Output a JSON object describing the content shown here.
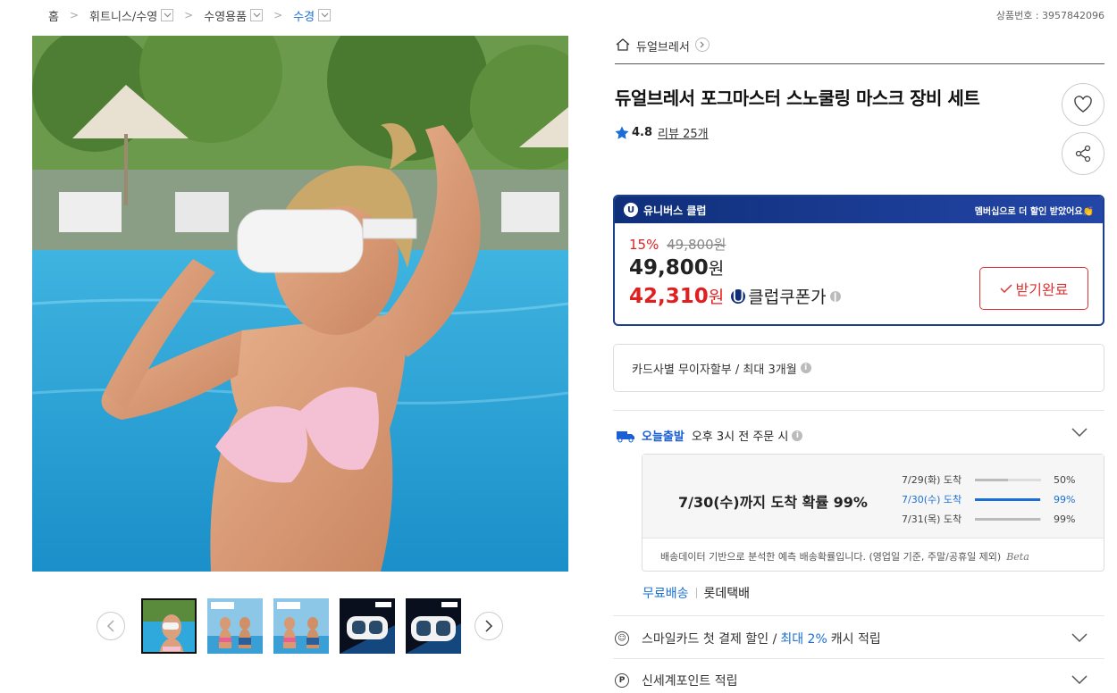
{
  "breadcrumb": {
    "items": [
      "홈",
      "휘트니스/수영",
      "수영용품",
      "수경"
    ],
    "current_index": 3
  },
  "product_number": "상품번호 : 3957842096",
  "brand": {
    "name": "듀얼브레서"
  },
  "product": {
    "title": "듀얼브레서 포그마스터 스노쿨링 마스크 장비 세트",
    "rating": "4.8",
    "review_text": "리뷰 25개"
  },
  "club": {
    "name": "유니버스 클럽",
    "promo": "멤버십으로 더 할인 받았어요👏",
    "discount_pct": "15%",
    "original_price": "49,800원",
    "price_num": "49,800",
    "price_unit": "원",
    "club_price_num": "42,310",
    "club_price_unit": "원",
    "coupon_label": "클럽쿠폰가",
    "receive_button": "받기완료"
  },
  "card": {
    "text": "카드사별 무이자할부 / 최대 3개월"
  },
  "delivery": {
    "badge": "오늘출발",
    "text": "오후 3시 전 주문 시",
    "headline": "7/30(수)까지 도착 확률 99%",
    "rows": [
      {
        "label": "7/29(화) 도착",
        "percent": "50%",
        "value": 0.5,
        "active": false
      },
      {
        "label": "7/30(수) 도착",
        "percent": "99%",
        "value": 0.99,
        "active": true
      },
      {
        "label": "7/31(목) 도착",
        "percent": "99%",
        "value": 0.99,
        "active": false
      }
    ],
    "note": "배송데이터 기반으로 분석한 예측 배송확률입니다. (영업일 기준, 주말/공휴일 제외)",
    "beta": "Beta"
  },
  "shipping": {
    "free": "무료배송",
    "carrier": "롯데택배"
  },
  "benefits": [
    {
      "pre": "스마일카드 첫 결제 할인 /",
      "highlight": "최대 2%",
      "post": "캐시 적립"
    },
    {
      "pre": "신세계포인트 적립",
      "highlight": "",
      "post": ""
    }
  ],
  "colors": {
    "accent_blue": "#1a6fd6",
    "sale_red": "#e02020",
    "club_navy": "#1d3f8c"
  },
  "icons": [
    "home-icon",
    "chevron-right-icon",
    "heart-icon",
    "share-icon",
    "star-icon",
    "info-icon",
    "chevron-down-icon",
    "truck-icon",
    "smile-icon",
    "point-icon"
  ]
}
